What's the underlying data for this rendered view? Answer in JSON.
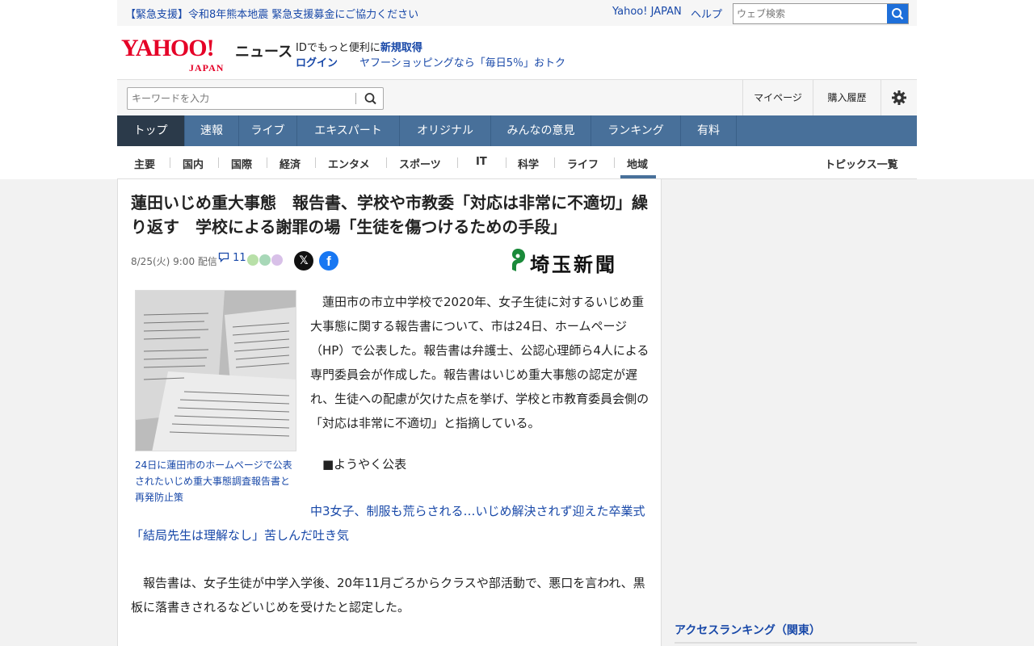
{
  "emergency": {
    "alert": "【緊急支援】令和8年熊本地震 緊急支援募金にご協力ください",
    "yahoo_japan": "Yahoo! JAPAN",
    "help": "ヘルプ",
    "web_search_placeholder": "ウェブ検索"
  },
  "header": {
    "logo_main": "YAHOO!",
    "logo_sub": "JAPAN",
    "service": "ニュース",
    "id_prefix": "IDでもっと便利に",
    "register": "新規取得",
    "login": "ログイン",
    "promo": "ヤフーショッピングなら「毎日5％」おトク"
  },
  "search": {
    "placeholder": "キーワードを入力",
    "mypage": "マイページ",
    "history": "購入履歴"
  },
  "main_nav": [
    {
      "label": "トップ",
      "active": true
    },
    {
      "label": "速報"
    },
    {
      "label": "ライブ"
    },
    {
      "label": "エキスパート"
    },
    {
      "label": "オリジナル"
    },
    {
      "label": "みんなの意見"
    },
    {
      "label": "ランキング"
    },
    {
      "label": "有料"
    }
  ],
  "sub_nav": [
    {
      "label": "主要"
    },
    {
      "label": "国内"
    },
    {
      "label": "国際"
    },
    {
      "label": "経済"
    },
    {
      "label": "エンタメ"
    },
    {
      "label": "スポーツ"
    },
    {
      "label": "IT"
    },
    {
      "label": "科学"
    },
    {
      "label": "ライフ"
    },
    {
      "label": "地域",
      "active": true
    }
  ],
  "topics_list": "トピックス一覧",
  "article": {
    "headline": "蓮田いじめ重大事態　報告書、学校や市教委「対応は非常に不適切」繰り返す　学校による謝罪の場「生徒を傷つけるための手段」",
    "datetime": "8/25(火) 9:00 配信",
    "comment_count": "11",
    "x_icon": "x-logo",
    "fb_icon": "facebook-logo",
    "publisher": "埼玉新聞",
    "photo_caption": "24日に蓮田市のホームページで公表されたいじめ重大事態調査報告書と再発防止策",
    "body": "　蓮田市の市立中学校で2020年、女子生徒に対するいじめ重大事態に関する報告書について、市は24日、ホームページ（HP）で公表した。報告書は弁護士、公認心理師ら4人による専門委員会が作成した。報告書はいじめ重大事態の認定が遅れ、生徒への配慮が欠けた点を挙げ、学校と市教育委員会側の「対応は非常に不適切」と指摘している。",
    "subheading": "　■ようやく公表",
    "related_link": "中3女子、制服も荒らされる…いじめ解決されず迎えた卒業式「結局先生は理解なし」苦しんだ吐き気",
    "paragraph2": "　報告書は、女子生徒が中学入学後、20年11月ごろからクラスや部活動で、悪口を言われ、黒板に落書きされるなどいじめを受けたと認定した。"
  },
  "sidebar": {
    "ranking_title": "アクセスランキング（関東）"
  },
  "colors": {
    "nav_bg": "#48709a",
    "nav_active": "#2b3a4a",
    "link": "#1848a8",
    "brand_red": "#e50027",
    "search_blue": "#1e6fd9"
  }
}
